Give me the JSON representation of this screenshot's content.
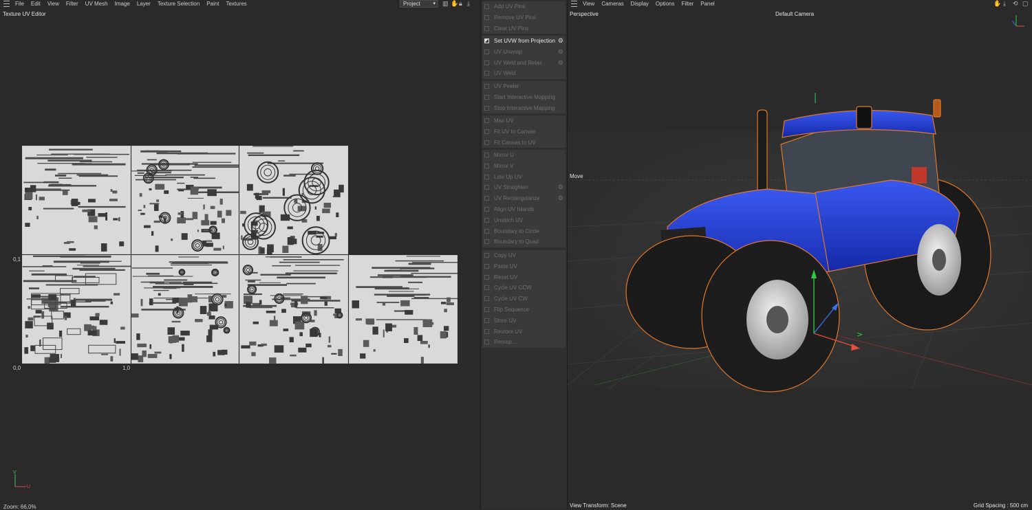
{
  "uv_editor": {
    "menu": [
      "File",
      "Edit",
      "View",
      "Filter",
      "UV Mesh",
      "Image",
      "Layer",
      "Texture Selection",
      "Paint",
      "Textures"
    ],
    "title": "Texture UV Editor",
    "mode_dropdown": "Project",
    "axis_labels": {
      "origin": "0,0",
      "u_one": "1,0",
      "v_one": "0,1",
      "v_axis": "V",
      "u_axis": "U"
    },
    "status": "Zoom: 66,0%"
  },
  "commands": {
    "groups": [
      [
        {
          "label": "Add UV Pins",
          "enabled": false
        },
        {
          "label": "Remove UV Pins",
          "enabled": false
        },
        {
          "label": "Clear UV Pins",
          "enabled": false
        }
      ],
      [
        {
          "label": "Set UVW from Projection",
          "enabled": true,
          "gear": true
        },
        {
          "label": "UV Unwrap",
          "enabled": false,
          "gear": true
        },
        {
          "label": "UV Weld and Relax",
          "enabled": false,
          "gear": true
        },
        {
          "label": "UV Weld",
          "enabled": false
        }
      ],
      [
        {
          "label": "UV Peeler",
          "enabled": false
        },
        {
          "label": "Start Interactive Mapping",
          "enabled": false
        },
        {
          "label": "Stop Interactive Mapping",
          "enabled": false
        }
      ],
      [
        {
          "label": "Max UV",
          "enabled": false
        },
        {
          "label": "Fit UV to Canvas",
          "enabled": false
        },
        {
          "label": "Fit Canvas to UV",
          "enabled": false
        }
      ],
      [
        {
          "label": "Mirror U",
          "enabled": false
        },
        {
          "label": "Mirror V",
          "enabled": false
        },
        {
          "label": "Line Up UV",
          "enabled": false
        },
        {
          "label": "UV Straighten",
          "enabled": false,
          "gear": true
        },
        {
          "label": "UV Rectangularize",
          "enabled": false,
          "gear": true
        },
        {
          "label": "Align UV Islands",
          "enabled": false
        },
        {
          "label": "Unstitch UV",
          "enabled": false
        },
        {
          "label": "Boundary to Circle",
          "enabled": false
        },
        {
          "label": "Boundary to Quad",
          "enabled": false
        }
      ],
      [
        {
          "label": "Copy UV",
          "enabled": false
        },
        {
          "label": "Paste UV",
          "enabled": false
        },
        {
          "label": "Reset UV",
          "enabled": false
        },
        {
          "label": "Cycle UV CCW",
          "enabled": false
        },
        {
          "label": "Cycle UV CW",
          "enabled": false
        },
        {
          "label": "Flip Sequence",
          "enabled": false
        },
        {
          "label": "Store UV",
          "enabled": false
        },
        {
          "label": "Restore UV",
          "enabled": false
        },
        {
          "label": "Remap...",
          "enabled": false
        }
      ]
    ]
  },
  "viewport": {
    "menu": [
      "View",
      "Cameras",
      "Display",
      "Options",
      "Filter",
      "Panel"
    ],
    "projection": "Perspective",
    "camera": "Default Camera",
    "tool": "Move",
    "view_transform": "View Transform: Scene",
    "grid_spacing": "Grid Spacing : 500 cm"
  },
  "colors": {
    "uv_tile": "#d9d9d9",
    "tractor_body": "#1f3ad6",
    "selection_outline": "#e0782a"
  }
}
